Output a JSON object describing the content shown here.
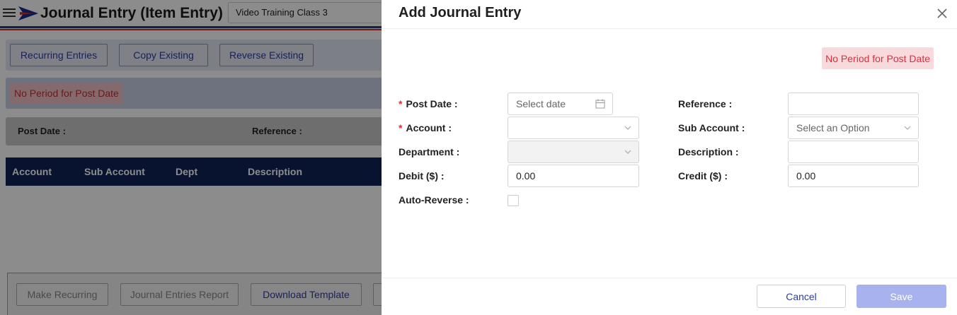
{
  "page": {
    "title": "Journal Entry (Item Entry)",
    "org_select": "Video Training Class 3",
    "actions": [
      "Recurring Entries",
      "Copy Existing",
      "Reverse Existing"
    ],
    "alert": "No Period for Post Date",
    "info": {
      "post_date_label": "Post Date",
      "reference_label": "Reference"
    },
    "grid_columns": [
      "Account",
      "Sub Account",
      "Dept",
      "Description"
    ],
    "footer_buttons": [
      "Make Recurring",
      "Journal Entries Report",
      "Download Template"
    ]
  },
  "drawer": {
    "title": "Add Journal Entry",
    "alert": "No Period for Post Date",
    "fields": {
      "post_date": {
        "label": "Post Date",
        "placeholder": "Select date"
      },
      "reference": {
        "label": "Reference",
        "value": ""
      },
      "account": {
        "label": "Account",
        "value": ""
      },
      "sub_account": {
        "label": "Sub Account",
        "placeholder": "Select an Option"
      },
      "department": {
        "label": "Department",
        "value": ""
      },
      "description": {
        "label": "Description",
        "value": ""
      },
      "debit": {
        "label": "Debit ($)",
        "value": "0.00"
      },
      "credit": {
        "label": "Credit ($)",
        "value": "0.00"
      },
      "auto_reverse": {
        "label": "Auto-Reverse",
        "checked": false
      }
    },
    "cancel_label": "Cancel",
    "save_label": "Save"
  },
  "colors": {
    "accent": "#2b3ea0",
    "grid_header": "#0f2457",
    "alert_text": "#d9303f",
    "save_disabled": "#a7b2ef"
  }
}
